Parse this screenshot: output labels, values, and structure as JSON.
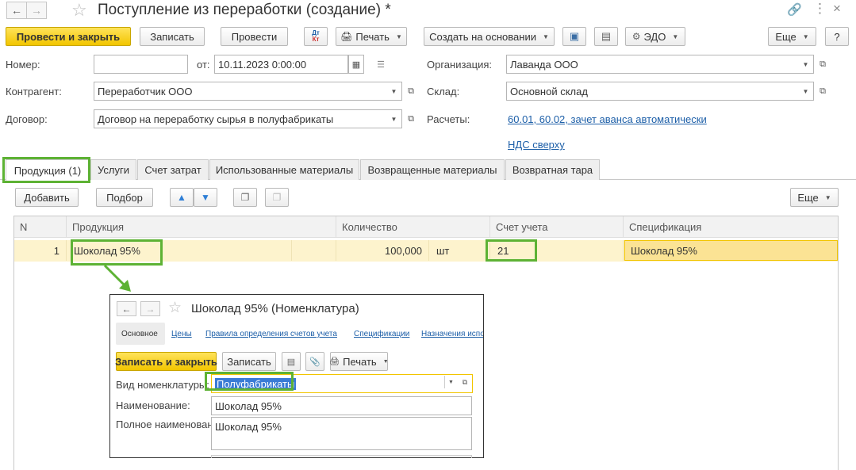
{
  "window": {
    "title": "Поступление из переработки (создание) *",
    "back_icon": "arrow-left",
    "forward_icon": "arrow-right",
    "favorite_icon": "star",
    "link_icon": "link",
    "menu_icon": "more-vertical",
    "close_icon": "close"
  },
  "toolbar": {
    "post_close": "Провести и закрыть",
    "save": "Записать",
    "post": "Провести",
    "dtkt_top": "Дт",
    "dtkt_bottom": "Кт",
    "print": "Печать",
    "create_based": "Создать на основании",
    "edo": "ЭДО",
    "more": "Еще",
    "help": "?"
  },
  "form": {
    "number_label": "Номер:",
    "number_value": "",
    "date_label": "от:",
    "date_value": "10.11.2023  0:00:00",
    "org_label": "Организация:",
    "org_value": "Лаванда ООО",
    "contractor_label": "Контрагент:",
    "contractor_value": "Переработчик ООО",
    "warehouse_label": "Склад:",
    "warehouse_value": "Основной склад",
    "contract_label": "Договор:",
    "contract_value": "Договор на переработку сырья в полуфабрикаты",
    "payments_label": "Расчеты:",
    "payments_link": "60.01, 60.02, зачет аванса автоматически",
    "vat_link": "НДС сверху"
  },
  "tabs": [
    {
      "label": "Продукция (1)",
      "active": true
    },
    {
      "label": "Услуги"
    },
    {
      "label": "Счет затрат"
    },
    {
      "label": "Использованные материалы"
    },
    {
      "label": "Возвращенные материалы"
    },
    {
      "label": "Возвратная тара"
    }
  ],
  "table_toolbar": {
    "add": "Добавить",
    "select": "Подбор",
    "more": "Еще"
  },
  "table": {
    "columns": [
      "N",
      "Продукция",
      "Количество",
      "Счет учета",
      "Спецификация"
    ],
    "rows": [
      {
        "n": "1",
        "product": "Шоколад 95%",
        "quantity": "100,000",
        "unit": "шт",
        "account": "21",
        "spec": "Шоколад 95%"
      }
    ]
  },
  "popup": {
    "title": "Шоколад 95% (Номенклатура)",
    "tabs": [
      "Основное",
      "Цены",
      "Правила определения счетов учета",
      "Спецификации",
      "Назначения испо"
    ],
    "save_close": "Записать и закрыть",
    "save": "Записать",
    "print": "Печать",
    "kind_label": "Вид номенклатуры:",
    "kind_value": "Полуфабрикаты",
    "name_label": "Наименование:",
    "name_value": "Шоколад 95%",
    "fullname_label": "Полное наименование:",
    "fullname_value": "Шоколад 95%"
  },
  "colors": {
    "accent_yellow": "#f2c500",
    "highlight_green": "#5db234",
    "row_selected": "#fdf3cd",
    "link_blue": "#1d5fa8"
  }
}
